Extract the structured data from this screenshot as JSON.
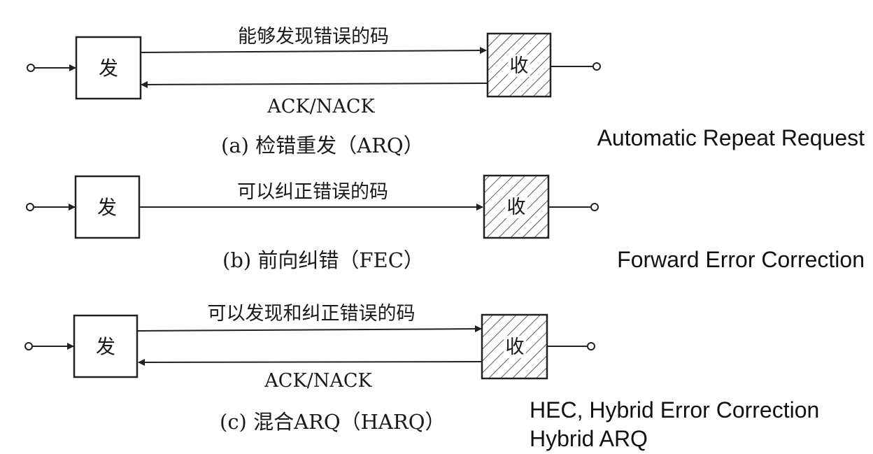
{
  "diagrams": [
    {
      "id": "a",
      "sender_label": "发",
      "receiver_label": "收",
      "forward_label": "能够发现错误的码",
      "feedback_label": "ACK/NACK",
      "caption": "(a) 检错重发（ARQ）",
      "english_note": "Automatic Repeat Request"
    },
    {
      "id": "b",
      "sender_label": "发",
      "receiver_label": "收",
      "forward_label": "可以纠正错误的码",
      "caption": "(b) 前向纠错（FEC）",
      "english_note": "Forward Error Correction"
    },
    {
      "id": "c",
      "sender_label": "发",
      "receiver_label": "收",
      "forward_label": "可以发现和纠正错误的码",
      "feedback_label": "ACK/NACK",
      "caption": "(c) 混合ARQ（HARQ）",
      "english_note": "HEC, Hybrid Error Correction",
      "english_note_2": "Hybrid ARQ"
    }
  ]
}
